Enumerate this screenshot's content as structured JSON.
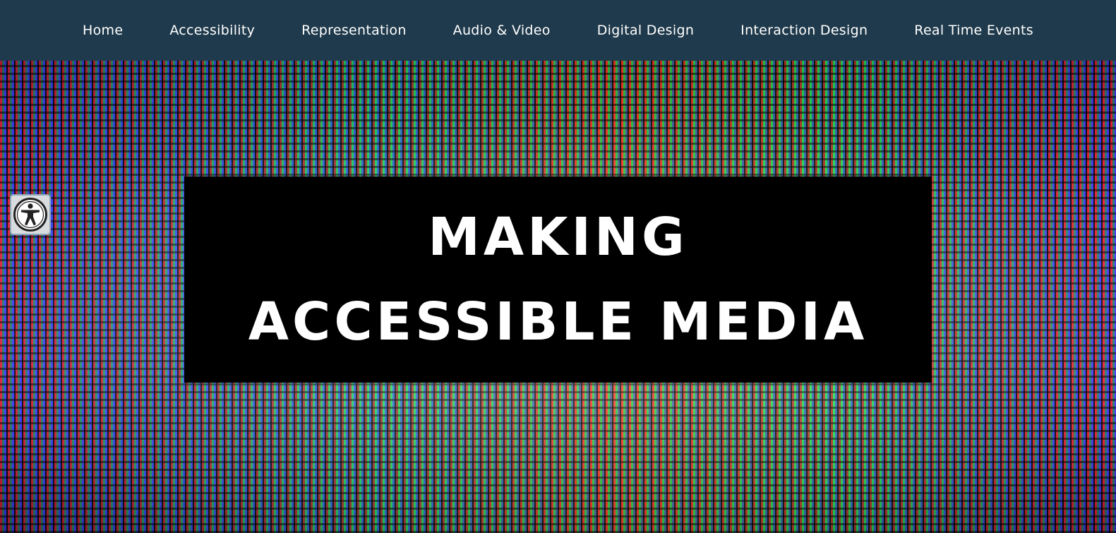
{
  "nav": {
    "items": [
      {
        "label": "Home"
      },
      {
        "label": "Accessibility"
      },
      {
        "label": "Representation"
      },
      {
        "label": "Audio & Video"
      },
      {
        "label": "Digital Design"
      },
      {
        "label": "Interaction Design"
      },
      {
        "label": "Real Time Events"
      }
    ]
  },
  "hero": {
    "title": "MAKING ACCESSIBLE MEDIA"
  },
  "accessibility_widget": {
    "icon": "accessibility-person-icon"
  },
  "colors": {
    "nav_background": "#1f3a4c",
    "title_box_background": "#000000",
    "text": "#ffffff"
  }
}
